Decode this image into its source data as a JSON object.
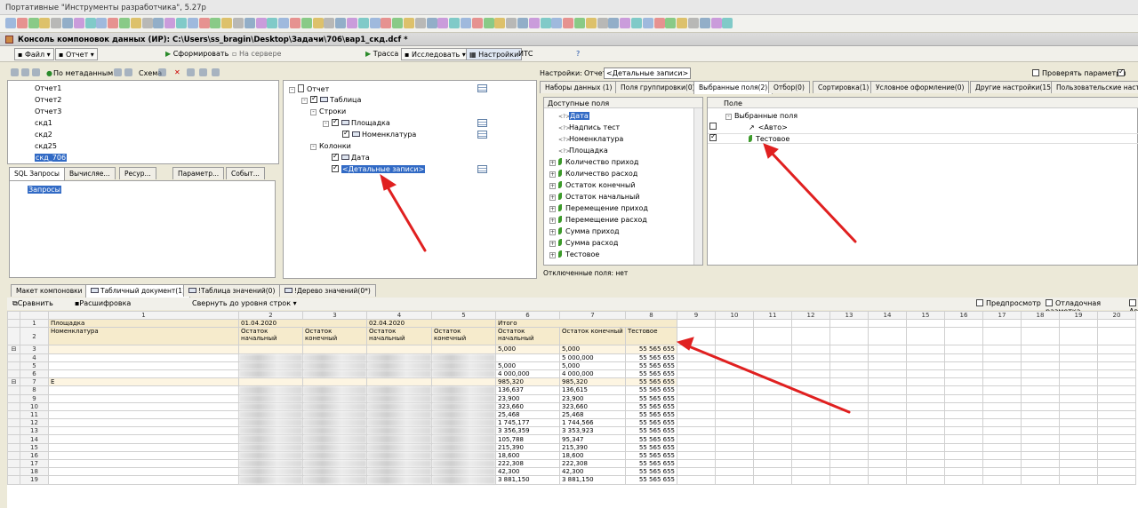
{
  "app_title": "Портативные \"Инструменты разработчика\", 5.27p",
  "window_title": "Консоль компоновок данных (ИР): C:\\Users\\ss_bragin\\Desktop\\Задачи\\706\\вар1_скд.dcf *",
  "toolbar": {
    "file": "Файл",
    "report": "Отчет",
    "generate": "Сформировать",
    "on_server": "На сервере",
    "trace": "Трасса",
    "investigate": "Исследовать",
    "settings": "Настройки",
    "its": "ИТС"
  },
  "left": {
    "by_metadata": "По метаданным",
    "schema": "Схема",
    "items": [
      "Отчет1",
      "Отчет2",
      "Отчет3",
      "скд1",
      "скд2",
      "скд25",
      "скд_706"
    ],
    "tabs": [
      "SQL Запросы",
      "Вычисляе...",
      "Ресур...",
      "Параметр...",
      "Событ..."
    ],
    "queries": "Запросы"
  },
  "middle": {
    "report": "Отчет",
    "table": "Таблица",
    "rows": "Строки",
    "site": "Площадка",
    "nomen": "Номенклатура",
    "columns": "Колонки",
    "date": "Дата",
    "detail": "<Детальные записи>"
  },
  "right": {
    "settings_label": "Настройки:",
    "report_label": "Отчет",
    "detail": "<Детальные записи>",
    "check_params": "Проверять параметры",
    "tabs": [
      "Наборы данных (1)",
      "Поля группировки(0)",
      "Выбранные поля(2)",
      "Отбор(0)",
      "Сортировка(1)",
      "Условное оформление(0)",
      "Другие настройки(15)",
      "Пользовательские настр"
    ],
    "avail_header": "Доступные поля",
    "avail": [
      "Дата",
      "Надпись тест",
      "Номенклатура",
      "Площадка",
      "Количество приход",
      "Количество расход",
      "Остаток конечный",
      "Остаток начальный",
      "Перемещение приход",
      "Перемещение расход",
      "Сумма приход",
      "Сумма расход",
      "Тестовое"
    ],
    "disabled": "Отключенные поля: нет",
    "field_header": "Поле",
    "selected_root": "Выбранные поля",
    "auto": "<Авто>",
    "test": "Тестовое"
  },
  "bottom_tabs": [
    "Макет компоновки",
    "Табличный документ(1)",
    "!Таблица значений(0)",
    "!Дерево значений(0*)"
  ],
  "bottom_tb": {
    "compare": "Сравнить",
    "decode": "Расшифровка",
    "collapse": "Свернуть до уровня строк",
    "preview": "Предпросмотр",
    "debug_layout": "Отладочная разметка",
    "ae": "Ав"
  },
  "sheet": {
    "col_headers": [
      "1",
      "2",
      "3",
      "4",
      "5",
      "6",
      "7",
      "8",
      "9",
      "10",
      "11",
      "12",
      "13",
      "14",
      "15",
      "16",
      "17",
      "18",
      "19",
      "20"
    ],
    "row1": {
      "c1": "Площадка",
      "c2": "01.04.2020",
      "c4": "02.04.2020",
      "c6": "Итого"
    },
    "row2": {
      "c1": "Номенклатура",
      "c2": "Остаток начальный",
      "c3": "Остаток конечный",
      "c4": "Остаток начальный",
      "c5": "Остаток конечный",
      "c6": "Остаток начальный",
      "c7": "Остаток конечный",
      "c8": "Тестовое"
    },
    "row_nums": [
      "1",
      "2",
      "3",
      "4",
      "5",
      "6",
      "7",
      "8",
      "9",
      "10",
      "11",
      "12",
      "13",
      "14",
      "15",
      "16",
      "17",
      "18",
      "19"
    ],
    "row7_text": "Е",
    "data": [
      [
        "5,000",
        "5,000",
        "55 565 655"
      ],
      [
        "",
        "5 000,000",
        "55 565 655"
      ],
      [
        "5,000",
        "5,000",
        "55 565 655"
      ],
      [
        "4 000,000",
        "4 000,000",
        "55 565 655"
      ],
      [
        "985,320",
        "985,320",
        "55 565 655"
      ],
      [
        "136,637",
        "136,615",
        "55 565 655"
      ],
      [
        "23,900",
        "23,900",
        "55 565 655"
      ],
      [
        "323,660",
        "323,660",
        "55 565 655"
      ],
      [
        "25,468",
        "25,468",
        "55 565 655"
      ],
      [
        "1 745,177",
        "1 744,566",
        "55 565 655"
      ],
      [
        "3 356,359",
        "3 353,923",
        "55 565 655"
      ],
      [
        "105,788",
        "95,347",
        "55 565 655"
      ],
      [
        "215,390",
        "215,390",
        "55 565 655"
      ],
      [
        "18,600",
        "18,600",
        "55 565 655"
      ],
      [
        "222,308",
        "222,308",
        "55 565 655"
      ],
      [
        "42,300",
        "42,300",
        "55 565 655"
      ],
      [
        "3 881,150",
        "3 881,150",
        "55 565 655"
      ]
    ]
  }
}
